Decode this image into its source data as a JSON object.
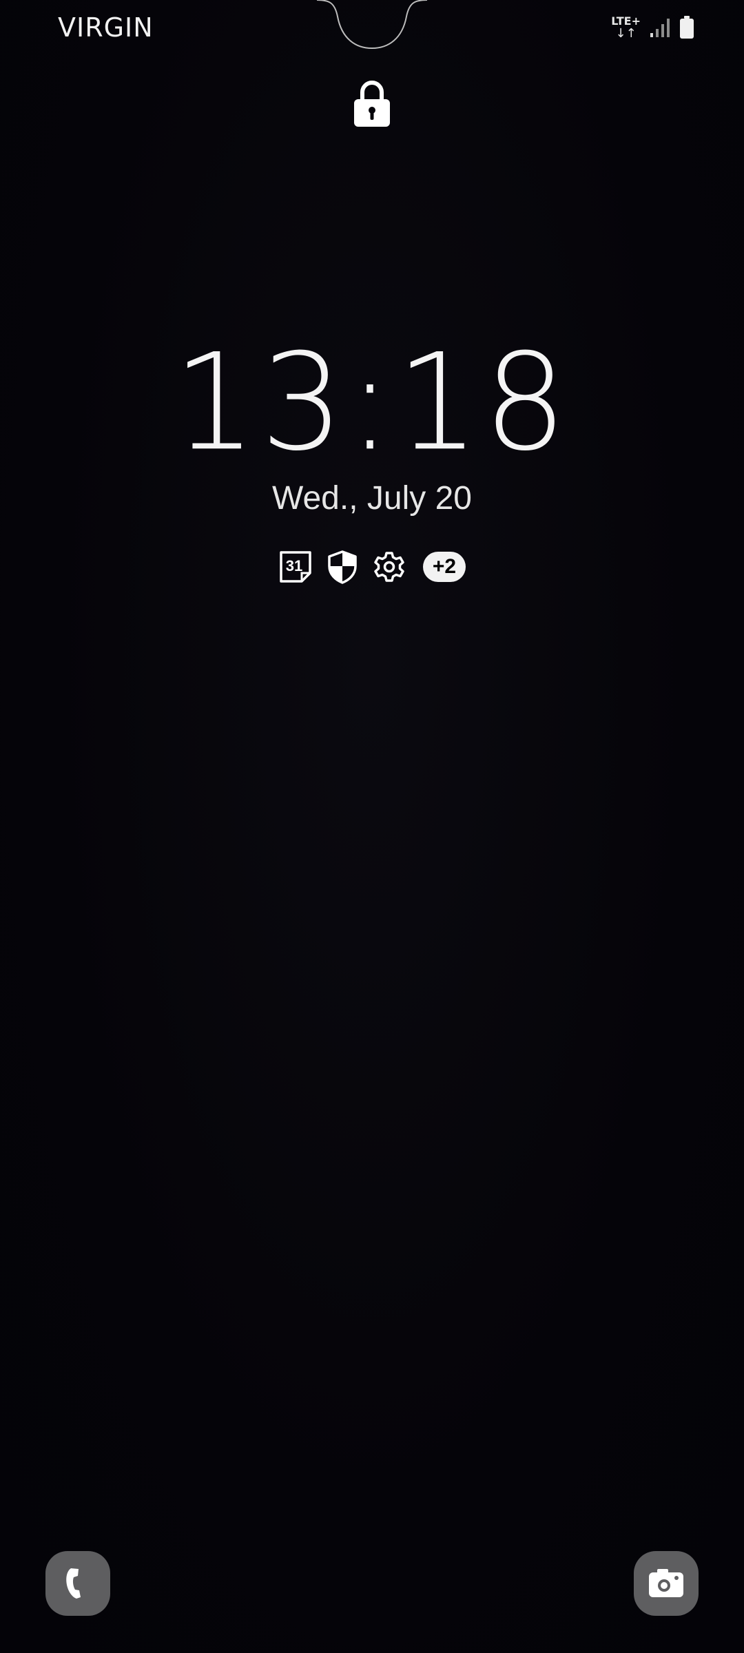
{
  "status_bar": {
    "carrier": "VIRGIN",
    "network_type": "LTE+",
    "data_arrows": "↓↑",
    "icons": [
      "signal-icon",
      "battery-icon"
    ]
  },
  "lock_screen": {
    "lock_icon": "lock-icon",
    "time": "13:18",
    "date": "Wed., July 20",
    "notification_icons": [
      "calendar-icon",
      "shield-icon",
      "settings-icon"
    ],
    "calendar_day": "31",
    "more_notifications": "+2"
  },
  "shortcuts": {
    "left": "phone-icon",
    "right": "camera-icon"
  },
  "colors": {
    "background": "#05040a",
    "text": "#ffffff",
    "shortcut_bg": "#5e5e60"
  }
}
